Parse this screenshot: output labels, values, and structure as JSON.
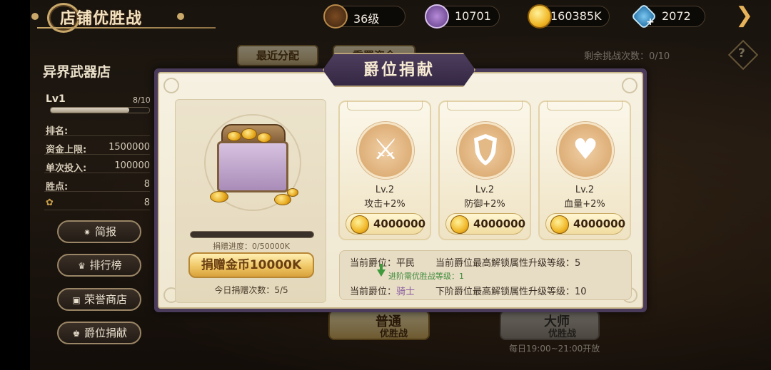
{
  "header": {
    "title": "店铺优胜战",
    "level": "36级",
    "res_2": "10701",
    "gold": "160385K",
    "diamond": "2072"
  },
  "sidebar": {
    "shop_name": "异界武器店",
    "lv_label": "Lv1",
    "lv_count": "8/10",
    "lv_progress": 0.8,
    "stats": [
      {
        "k": "排名:",
        "v": ""
      },
      {
        "k": "资金上限:",
        "v": "1500000"
      },
      {
        "k": "单次投入:",
        "v": "100000"
      },
      {
        "k": "胜点:",
        "v": "8"
      },
      {
        "k": "",
        "v": "8"
      }
    ],
    "buttons": [
      "简报",
      "排行榜",
      "荣誉商店",
      "爵位捐献"
    ]
  },
  "background": {
    "tab_recent": "最近分配",
    "tab_reset": "重置资金",
    "challenges_left": "剩余挑战次数：0/10",
    "normal_battle": "普通",
    "normal_battle_sub": "优胜战",
    "master_battle": "大师",
    "master_battle_sub": "优胜战",
    "open_time": "每日19:00~21:00开放"
  },
  "modal": {
    "title": "爵位捐献",
    "progress_text": "捐赠进度：0/50000K",
    "donate_button": "捐赠金币10000K",
    "today_count": "今日捐赠次数：5/5",
    "attrs": [
      {
        "icon": "sword-axe-icon",
        "lv": "Lv.2",
        "effect": "攻击+2%",
        "cost": "4000000"
      },
      {
        "icon": "shield-icon",
        "lv": "Lv.2",
        "effect": "防御+2%",
        "cost": "4000000"
      },
      {
        "icon": "heart-icon",
        "lv": "Lv.2",
        "effect": "血量+2%",
        "cost": "4000000"
      }
    ],
    "info": {
      "current_rank_label": "当前爵位：",
      "current_rank": "平民",
      "current_max_lv": "当前爵位最高解锁属性升级等级：5",
      "next_req": "进阶需优胜战等级：1",
      "next_rank_label": "当前爵位：",
      "next_rank": "骑士",
      "next_max_lv": "下阶爵位最高解锁属性升级等级：10"
    }
  },
  "colors": {
    "modal_border": "#4b3b5b",
    "gold": "#f0c766",
    "rank_highlight": "#8a5da0"
  }
}
